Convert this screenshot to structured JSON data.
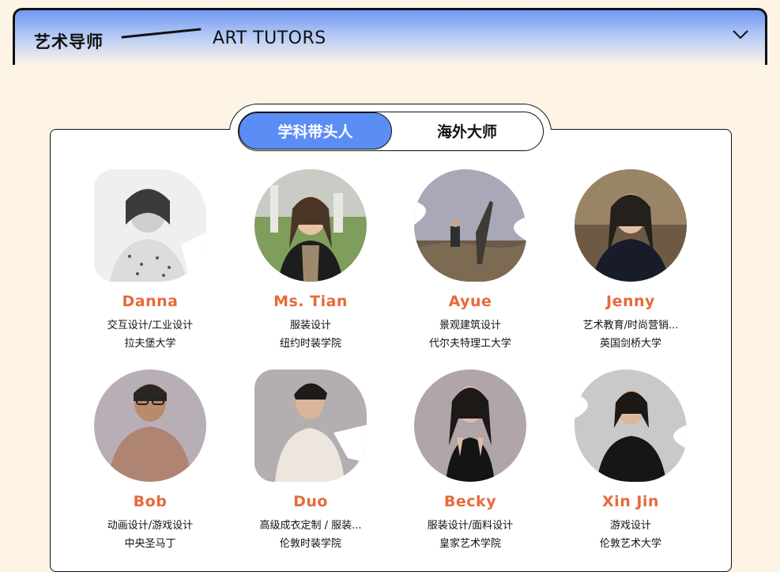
{
  "header": {
    "title_cn": "艺术导师",
    "title_en": "ART TUTORS"
  },
  "tabs": [
    {
      "label": "学科带头人",
      "active": true
    },
    {
      "label": "海外大师",
      "active": false
    }
  ],
  "colors": {
    "accent": "#5b8ef5",
    "name": "#e8693a",
    "background": "#fdf4e6"
  },
  "tutors": [
    {
      "name": "Danna",
      "major": "交互设计/工业设计",
      "school": "拉夫堡大学"
    },
    {
      "name": "Ms. Tian",
      "major": "服装设计",
      "school": "纽约时装学院"
    },
    {
      "name": "Ayue",
      "major": "景观建筑设计",
      "school": "代尔夫特理工大学"
    },
    {
      "name": "Jenny",
      "major": "艺术教育/时尚营销...",
      "school": "英国剑桥大学"
    },
    {
      "name": "Bob",
      "major": "动画设计/游戏设计",
      "school": "中央圣马丁"
    },
    {
      "name": "Duo",
      "major": "高级成衣定制 / 服装...",
      "school": "伦敦时装学院"
    },
    {
      "name": "Becky",
      "major": "服装设计/面料设计",
      "school": "皇家艺术学院"
    },
    {
      "name": "Xin Jin",
      "major": "游戏设计",
      "school": "伦敦艺术大学"
    }
  ]
}
